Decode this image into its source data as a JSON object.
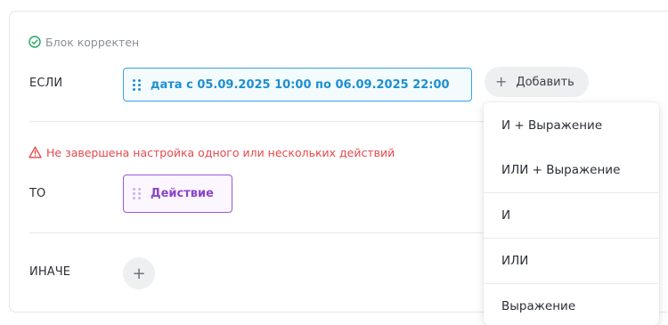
{
  "block": {
    "status_ok": "Блок корректен",
    "if_label": "ЕСЛИ",
    "condition": "дата с 05.09.2025 10:00 по 06.09.2025 22:00",
    "add_label": "Добавить",
    "status_warning": "Не завершена настройка одного или нескольких действий",
    "then_label": "ТО",
    "action": "Действие",
    "else_label": "ИНАЧЕ"
  },
  "add_menu": {
    "items": [
      "И + Выражение",
      "ИЛИ + Выражение",
      "И",
      "ИЛИ",
      "Выражение"
    ]
  },
  "colors": {
    "condition_accent": "#1c8fd1",
    "action_accent": "#8a46c9",
    "ok_gray": "#8a8f98",
    "warning_red": "#e5484d"
  },
  "icons": {
    "status_ok": "check-circle-icon",
    "status_warning": "warning-triangle-icon",
    "drag": "drag-handle-icon",
    "add": "plus-icon"
  }
}
